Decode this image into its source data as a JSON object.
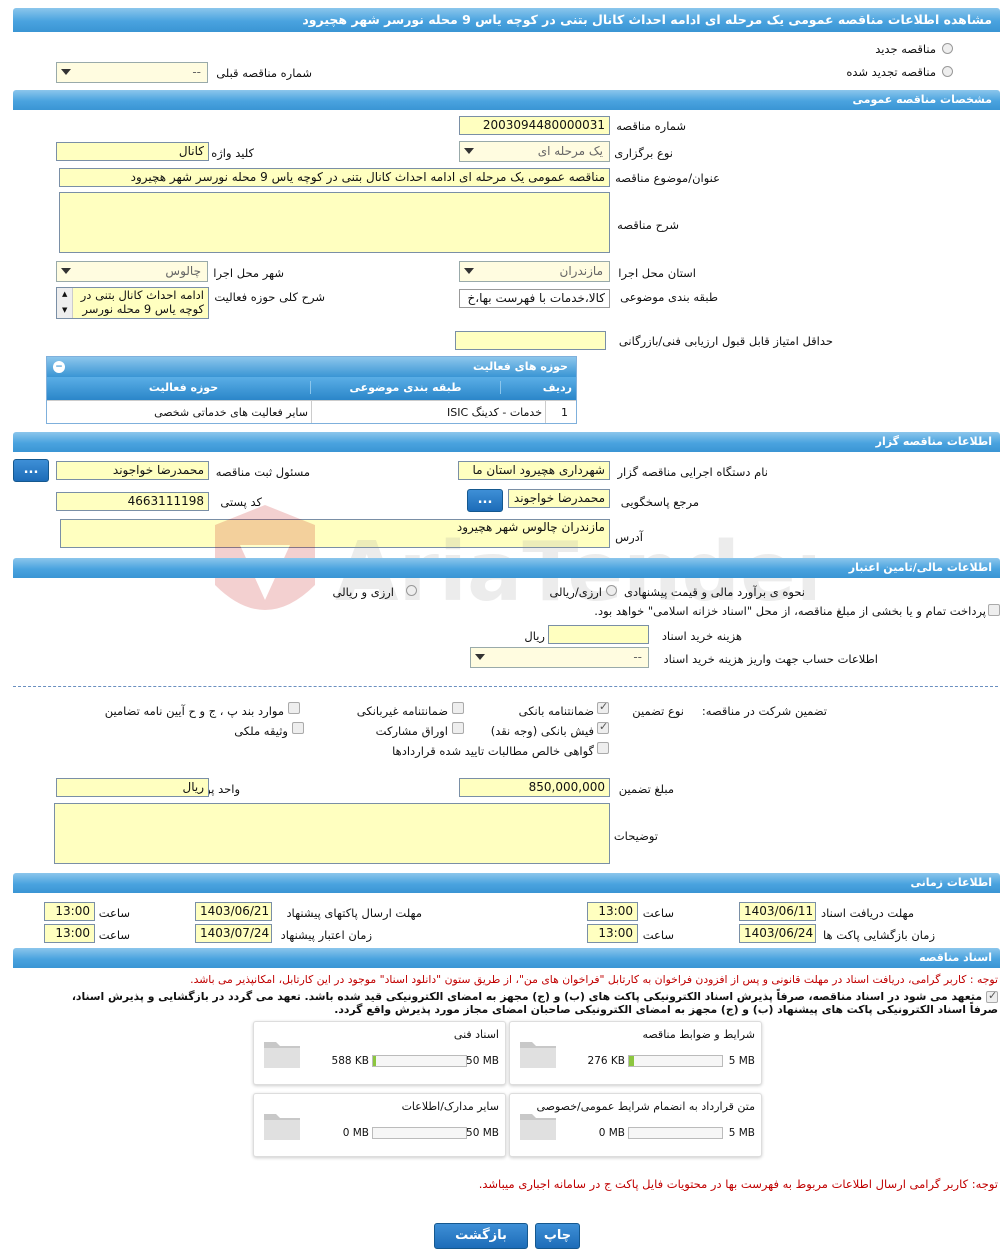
{
  "page_title": "مشاهده اطلاعات مناقصه عمومی یک مرحله ای ادامه احداث کانال بتنی در کوچه یاس 9 محله نورسر شهر هچیرود",
  "tender_type": {
    "new_label": "مناقصه جدید",
    "renewed_label": "مناقصه تجدید شده",
    "prev_number_label": "شماره مناقصه قبلی",
    "prev_number_value": "--"
  },
  "general": {
    "section_title": "مشخصات مناقصه عمومی",
    "number_label": "شماره مناقصه",
    "number_value": "2003094480000031",
    "hold_type_label": "نوع برگزاری",
    "hold_type_value": "یک مرحله ای",
    "keyword_label": "کلید واژه",
    "keyword_value": "کانال",
    "subject_label": "عنوان/موضوع مناقصه",
    "subject_value": "مناقصه عمومی یک مرحله ای ادامه احداث کانال بتنی در کوچه یاس 9 محله نورسر شهر هچیرود",
    "description_label": "شرح مناقصه",
    "description_value": "",
    "province_label": "استان محل اجرا",
    "province_value": "مازندران",
    "city_label": "شهر محل اجرا",
    "city_value": "چالوس",
    "category_label": "طبقه بندی موضوعی",
    "category_value": "کالا،خدمات با فهرست بها،خ",
    "activity_desc_label": "شرح کلی حوزه فعالیت",
    "activity_desc_value": "ادامه احداث کانال بتنی در کوچه یاس 9 محله نورسر",
    "min_score_label": "حداقل امتیاز قابل قبول ارزیابی فنی/بازرگانی",
    "min_score_value": ""
  },
  "activity_table": {
    "title": "حوزه های فعالیت",
    "headers": [
      "ردیف",
      "طبقه بندی موضوعی",
      "حوزه فعالیت"
    ],
    "rows": [
      [
        "1",
        "خدمات - کدینگ ISIC",
        "سایر فعالیت های خدماتی شخصی"
      ]
    ]
  },
  "organizer": {
    "section_title": "اطلاعات مناقصه گزار",
    "org_label": "نام دستگاه اجرایی مناقصه گزار",
    "org_value": "شهرداری هچیرود استان ما",
    "registrar_label": "مسئول ثبت مناقصه",
    "registrar_value": "محمدرضا خواجوند",
    "ref_label": "مرجع پاسخگویی",
    "ref_value": "محمدرضا خواجوند",
    "postal_label": "کد پستی",
    "postal_value": "4663111198",
    "address_label": "آدرس",
    "address_value": "مازندران چالوس شهر هچیرود",
    "more_button": "..."
  },
  "finance": {
    "section_title": "اطلاعات مالی/تامین اعتبار",
    "estimate_label": "نحوه ی برآورد مالی و قیمت پیشنهادی",
    "opt1": "ارزی/ریالی",
    "opt2": "ارزی و ریالی",
    "treasury_text": "پرداخت تمام و یا بخشی از مبلغ مناقصه، از محل \"اسناد خزانه اسلامی\" خواهد بود.",
    "doc_cost_label": "هزینه خرید اسناد",
    "doc_cost_value": "",
    "doc_cost_unit": "ریال",
    "account_label": "اطلاعات حساب جهت واریز هزینه خرید اسناد",
    "account_value": "--"
  },
  "guarantee": {
    "label": "تضمین شرکت در مناقصه:",
    "type_label": "نوع تضمین",
    "options": [
      {
        "label": "ضمانتنامه بانکی",
        "checked": true
      },
      {
        "label": "ضمانتنامه غیربانکی",
        "checked": false
      },
      {
        "label": "موارد بند پ ، ج و ح آیین نامه تضامین",
        "checked": false
      },
      {
        "label": "فیش بانکی (وجه نقد)",
        "checked": true
      },
      {
        "label": "اوراق مشارکت",
        "checked": false
      },
      {
        "label": "وثیقه ملکی",
        "checked": false
      },
      {
        "label": "گواهی خالص مطالبات تایید شده قراردادها",
        "checked": false
      }
    ],
    "amount_label": "مبلغ تضمین",
    "amount_value": "850,000,000",
    "currency_label": "واحد پول",
    "currency_value": "ریال",
    "notes_label": "توضیحات",
    "notes_value": ""
  },
  "timing": {
    "section_title": "اطلاعات زمانی",
    "receive_deadline_label": "مهلت دریافت اسناد",
    "receive_deadline_date": "1403/06/11",
    "receive_deadline_time": "13:00",
    "send_deadline_label": "مهلت ارسال پاکتهای پیشنهاد",
    "send_deadline_date": "1403/06/21",
    "send_deadline_time": "13:00",
    "opening_label": "زمان بازگشایی پاکت ها",
    "opening_date": "1403/06/24",
    "opening_time": "13:00",
    "validity_label": "زمان اعتبار پیشنهاد",
    "validity_date": "1403/07/24",
    "validity_time": "13:00",
    "time_label": "ساعت"
  },
  "documents": {
    "section_title": "اسناد مناقصه",
    "note1": "توجه : کاربر گرامی، دریافت اسناد در مهلت قانونی و پس از افزودن فراخوان به کارتابل \"فراخوان های من\"، از طریق ستون \"دانلود اسناد\" موجود در این کارتابل، امکانپذیر می باشد.",
    "commit_line1": "متعهد می شود در اسناد مناقصه، صرفاً پذیرش اسناد الکترونیکی پاکت های (ب) و (ج) مجهز به امضای الکترونیکی قید شده باشد. تعهد می گردد در بازگشایی و پذیرش اسناد،",
    "commit_line2": "صرفاً اسناد الکترونیکی پاکت های پیشنهاد (ب) و (ج) مجهز به امضای الکترونیکی صاحبان امضای مجاز مورد پذیرش واقع گردد.",
    "files": [
      {
        "name": "شرایط و ضوابط مناقصه",
        "used": "276 KB",
        "max": "5 MB",
        "fill": 0.05
      },
      {
        "name": "اسناد فنی",
        "used": "588 KB",
        "max": "50 MB",
        "fill": 0.01
      },
      {
        "name": "متن قرارداد به انضمام شرایط عمومی/خصوصی",
        "used": "0 MB",
        "max": "5 MB",
        "fill": 0
      },
      {
        "name": "سایر مدارک/اطلاعات",
        "used": "0 MB",
        "max": "50 MB",
        "fill": 0
      }
    ],
    "note2": "توجه: کاربر گرامی ارسال اطلاعات مربوط به فهرست بها در محتویات فایل پاکت ج در سامانه اجباری میباشد."
  },
  "buttons": {
    "back": "بازگشت",
    "print": "چاپ"
  },
  "watermark": "AriaTender.neT",
  "colors": {
    "header_blue": "#4aa3df",
    "input_yellow": "#ffffc0",
    "button_blue": "#1d6cb8",
    "alert_red": "#c00000"
  }
}
